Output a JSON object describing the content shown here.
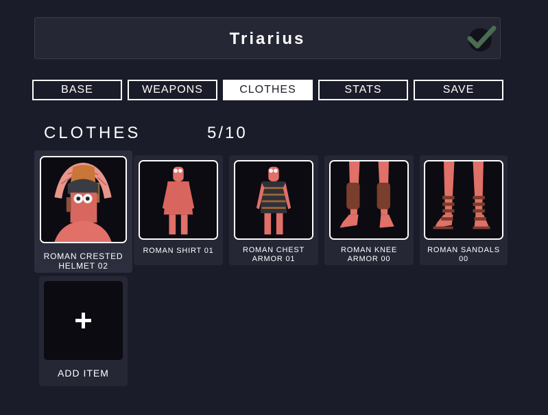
{
  "unit_name": "Triarius",
  "confirm_icon": "checkmark-icon",
  "tabs": [
    {
      "label": "BASE"
    },
    {
      "label": "WEAPONS"
    },
    {
      "label": "CLOTHES"
    },
    {
      "label": "STATS"
    },
    {
      "label": "SAVE"
    }
  ],
  "active_tab": "CLOTHES",
  "section": {
    "title": "CLOTHES",
    "count": "5/10"
  },
  "items": [
    {
      "line1": "ROMAN CRESTED",
      "line2": "HELMET 02"
    },
    {
      "line1": "ROMAN SHIRT 01",
      "line2": ""
    },
    {
      "line1": "ROMAN CHEST",
      "line2": "ARMOR 01"
    },
    {
      "line1": "ROMAN KNEE",
      "line2": "ARMOR 00"
    },
    {
      "line1": "ROMAN SANDALS",
      "line2": "00"
    }
  ],
  "add_item": {
    "label": "ADD ITEM",
    "icon": "plus-icon"
  },
  "colors": {
    "background": "#1b1c29",
    "panel": "#262735",
    "thumb_bg": "#0c0b12",
    "unit_skin": "#e07068"
  }
}
